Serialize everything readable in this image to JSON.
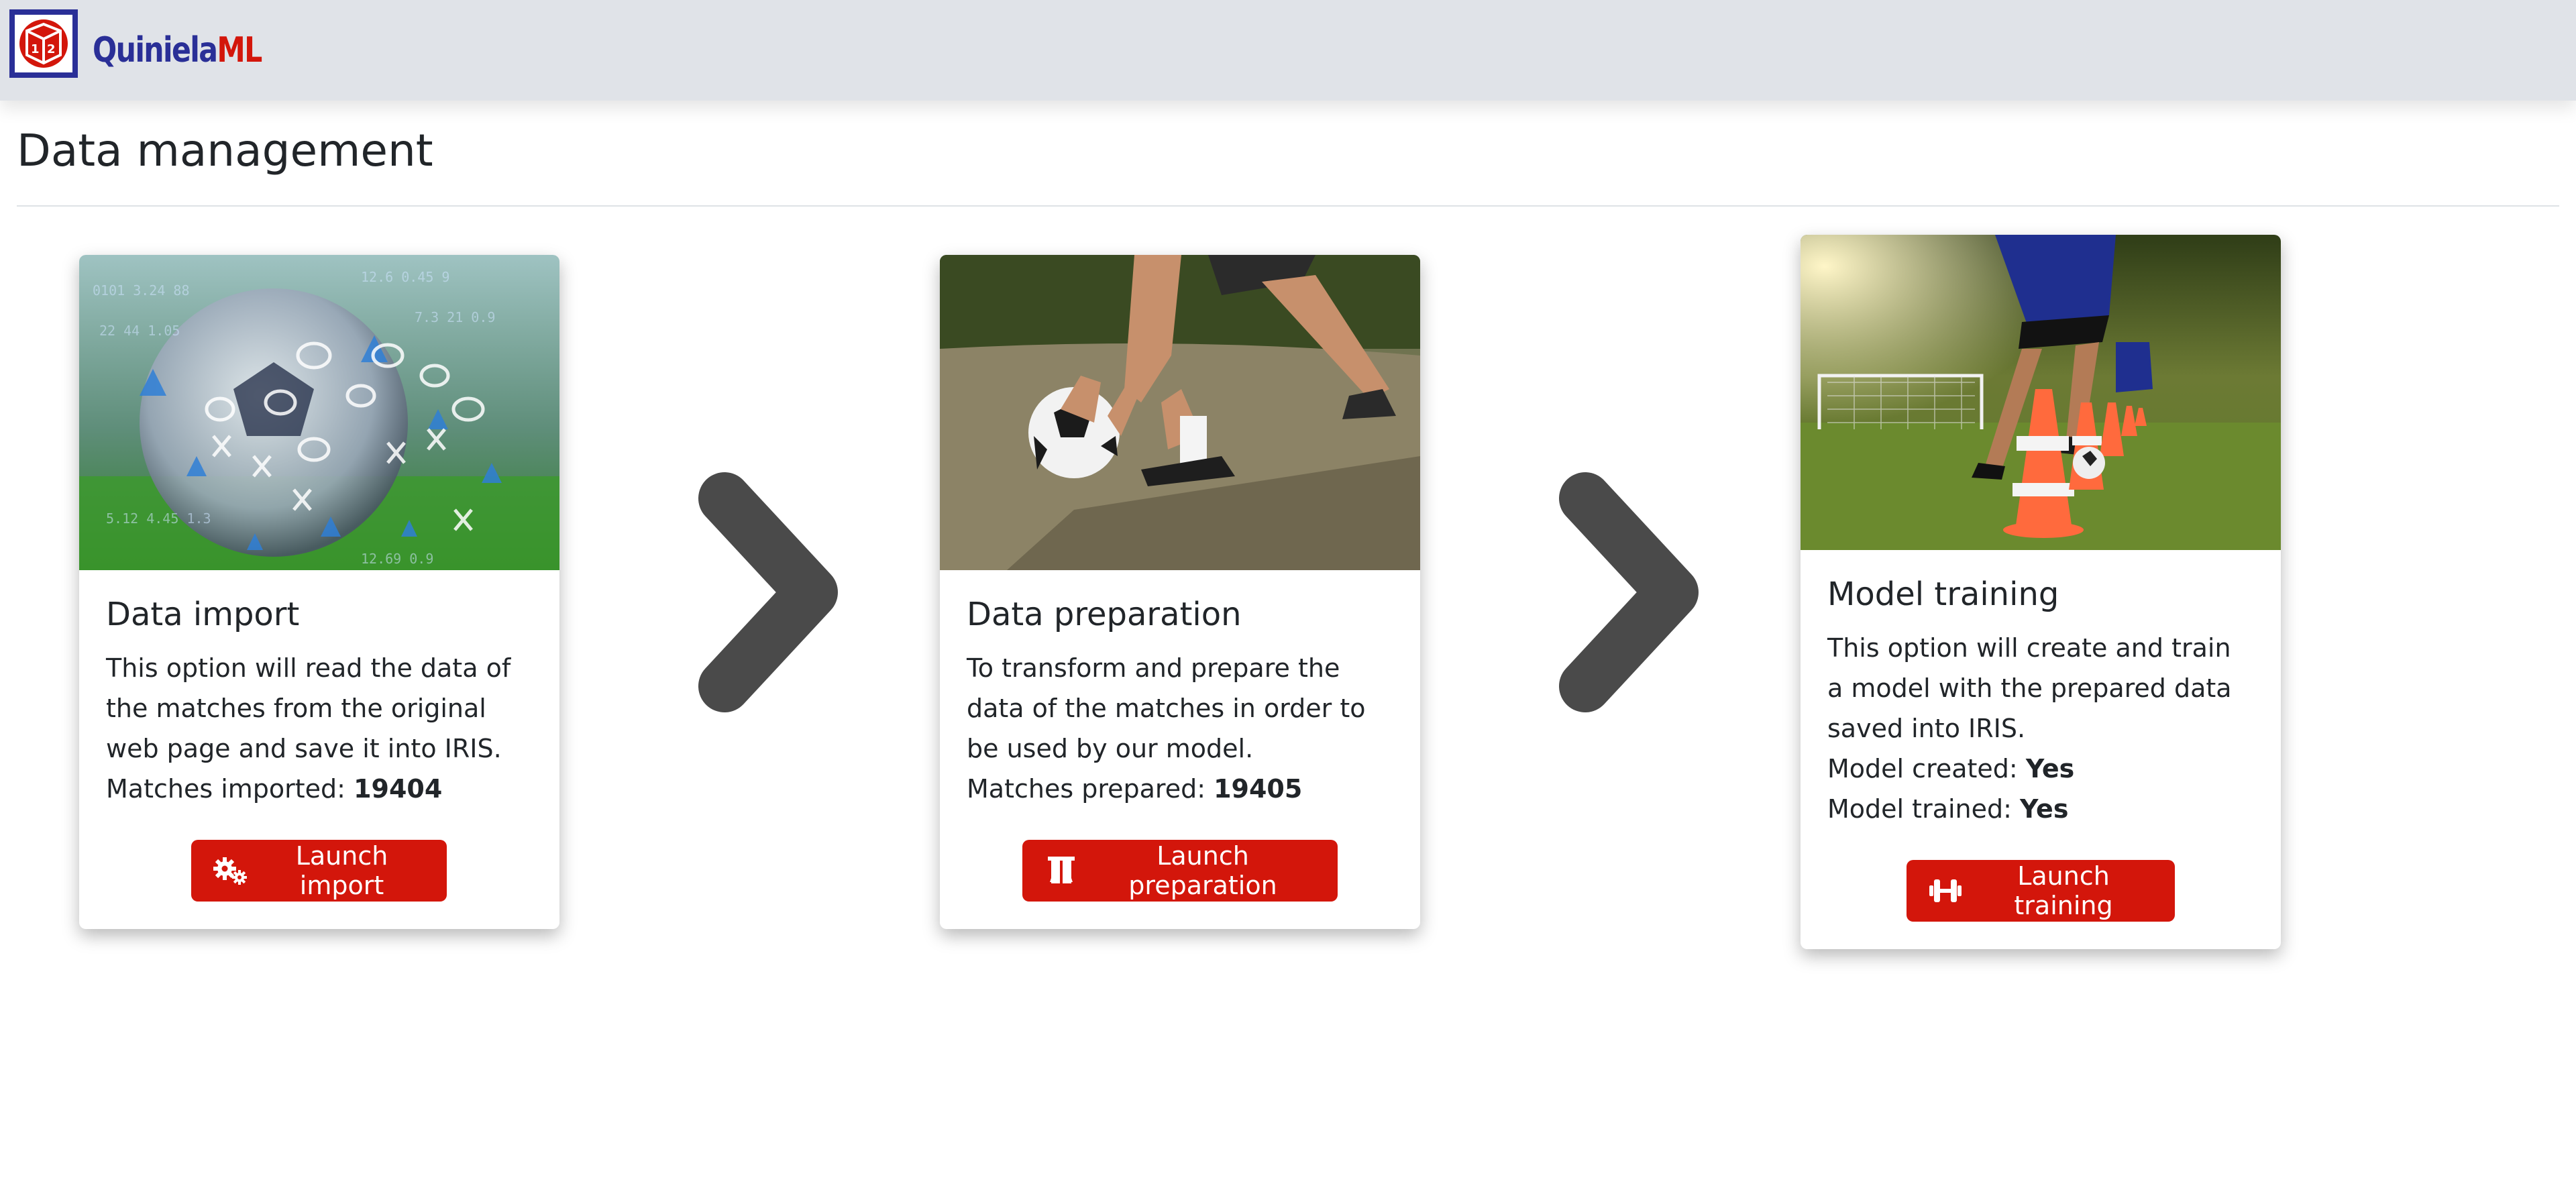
{
  "app": {
    "brand_part1": "Quiniela",
    "brand_part2": "ML",
    "colors": {
      "brand_blue": "#2a2f97",
      "brand_red": "#d3160b",
      "navbar_bg": "#e0e3e8",
      "arrow": "#4a4a4a"
    }
  },
  "page": {
    "title": "Data management"
  },
  "cards": [
    {
      "title": "Data import",
      "text": "This option will read the data of the matches from the original web page and save it into IRIS.",
      "stat_label": "Matches imported: ",
      "stat_value": "19404",
      "button_label": "Launch import",
      "button_icon": "gears-icon",
      "image": "soccer-ball-data-overlay"
    },
    {
      "title": "Data preparation",
      "text": "To transform and prepare the data of the matches in order to be used by our model.",
      "stat_label": "Matches prepared: ",
      "stat_value": "19405",
      "button_label": "Launch preparation",
      "button_icon": "flask-icon",
      "image": "player-holding-ball"
    },
    {
      "title": "Model training",
      "text": "This option will create and train a model with the prepared data saved into IRIS.",
      "stats": [
        {
          "label": "Model created: ",
          "value": "Yes"
        },
        {
          "label": "Model trained: ",
          "value": "Yes"
        }
      ],
      "button_label": "Launch training",
      "button_icon": "dumbbell-icon",
      "image": "players-training-cones"
    }
  ],
  "flow_arrows": [
    "chevron-right-icon",
    "chevron-right-icon"
  ]
}
